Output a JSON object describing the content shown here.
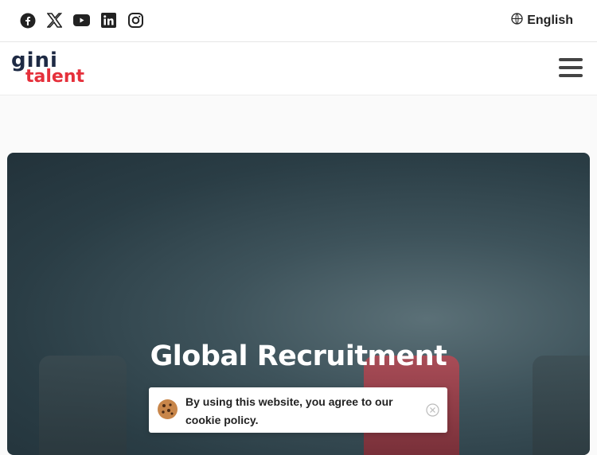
{
  "topbar": {
    "social_icons": [
      "facebook-icon",
      "x-twitter-icon",
      "youtube-icon",
      "linkedin-icon",
      "instagram-icon"
    ],
    "language": "English"
  },
  "logo": {
    "line1": "gini",
    "line2": "talent"
  },
  "hero": {
    "title": "Global Recruitment"
  },
  "cookie": {
    "text": "By using this website, you agree to our cookie policy."
  },
  "colors": {
    "brand_red": "#e5303b",
    "brand_navy": "#1e2a44",
    "hero_bg": "#2f434b"
  }
}
